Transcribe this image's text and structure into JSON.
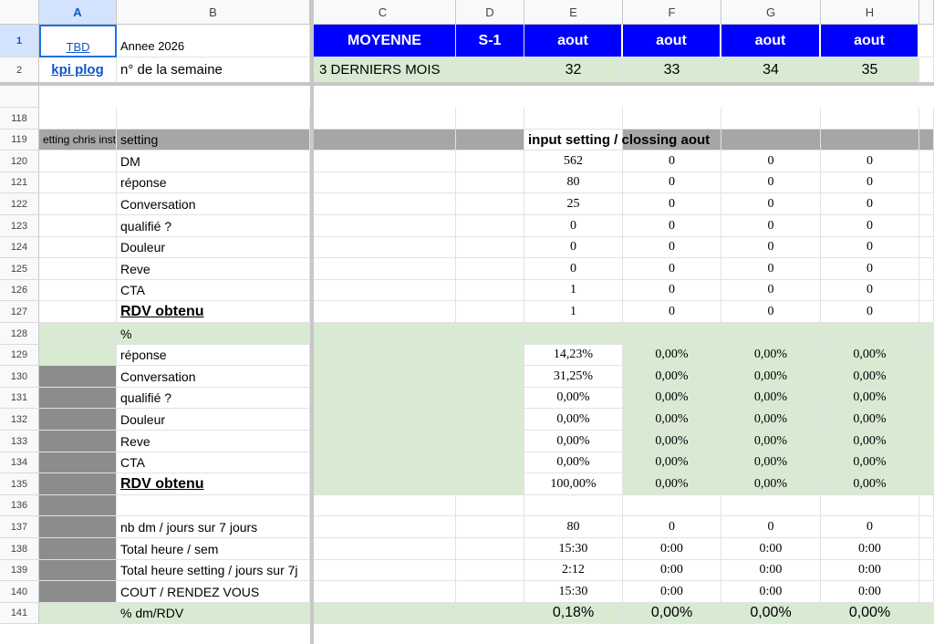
{
  "columns": [
    "A",
    "B",
    "C",
    "D",
    "E",
    "F",
    "G",
    "H"
  ],
  "header": {
    "row1_num": "1",
    "row2_num": "2",
    "a1": "TBD",
    "b1": "Annee 2026",
    "c1": "MOYENNE",
    "d1": "S-1",
    "months": [
      "aout",
      "aout",
      "aout",
      "aout"
    ],
    "a2": "kpi plog",
    "b2": "n° de la semaine",
    "c2": "3 DERNIERS MOIS",
    "weeks": [
      "32",
      "33",
      "34",
      "35"
    ]
  },
  "rows": [
    {
      "num": "118",
      "label": "",
      "vals": [
        "",
        "",
        "",
        ""
      ],
      "style": ""
    },
    {
      "num": "119",
      "label": "setting",
      "vals": [
        "",
        "",
        "",
        ""
      ],
      "style": "title"
    },
    {
      "num": "120",
      "label": "DM",
      "vals": [
        "562",
        "0",
        "0",
        "0"
      ],
      "style": ""
    },
    {
      "num": "121",
      "label": "réponse",
      "vals": [
        "80",
        "0",
        "0",
        "0"
      ],
      "style": ""
    },
    {
      "num": "122",
      "label": "Conversation",
      "vals": [
        "25",
        "0",
        "0",
        "0"
      ],
      "style": ""
    },
    {
      "num": "123",
      "label": "qualifié ?",
      "vals": [
        "0",
        "0",
        "0",
        "0"
      ],
      "style": ""
    },
    {
      "num": "124",
      "label": "Douleur",
      "vals": [
        "0",
        "0",
        "0",
        "0"
      ],
      "style": ""
    },
    {
      "num": "125",
      "label": "Reve",
      "vals": [
        "0",
        "0",
        "0",
        "0"
      ],
      "style": ""
    },
    {
      "num": "126",
      "label": "CTA",
      "vals": [
        "1",
        "0",
        "0",
        "0"
      ],
      "style": ""
    },
    {
      "num": "127",
      "label": "RDV obtenu",
      "vals": [
        "1",
        "0",
        "0",
        "0"
      ],
      "style": "bold"
    },
    {
      "num": "128",
      "label": "%",
      "vals": [
        "",
        "",
        "",
        ""
      ],
      "style": "greenrow"
    },
    {
      "num": "129",
      "label": "réponse",
      "vals": [
        "14,23%",
        "0,00%",
        "0,00%",
        "0,00%"
      ],
      "style": "pct"
    },
    {
      "num": "130",
      "label": "Conversation",
      "vals": [
        "31,25%",
        "0,00%",
        "0,00%",
        "0,00%"
      ],
      "style": "pct"
    },
    {
      "num": "131",
      "label": "qualifié ?",
      "vals": [
        "0,00%",
        "0,00%",
        "0,00%",
        "0,00%"
      ],
      "style": "pct"
    },
    {
      "num": "132",
      "label": "Douleur",
      "vals": [
        "0,00%",
        "0,00%",
        "0,00%",
        "0,00%"
      ],
      "style": "pct"
    },
    {
      "num": "133",
      "label": "Reve",
      "vals": [
        "0,00%",
        "0,00%",
        "0,00%",
        "0,00%"
      ],
      "style": "pct"
    },
    {
      "num": "134",
      "label": "CTA",
      "vals": [
        "0,00%",
        "0,00%",
        "0,00%",
        "0,00%"
      ],
      "style": "pct"
    },
    {
      "num": "135",
      "label": "RDV obtenu",
      "vals": [
        "100,00%",
        "0,00%",
        "0,00%",
        "0,00%"
      ],
      "style": "pctbold"
    },
    {
      "num": "136",
      "label": "",
      "vals": [
        "",
        "",
        "",
        ""
      ],
      "style": "gray"
    },
    {
      "num": "137",
      "label": "nb dm / jours sur 7 jours",
      "vals": [
        "80",
        "0",
        "0",
        "0"
      ],
      "style": "gray"
    },
    {
      "num": "138",
      "label": "Total heure / sem",
      "vals": [
        "15:30",
        "0:00",
        "0:00",
        "0:00"
      ],
      "style": "gray"
    },
    {
      "num": "139",
      "label": "Total heure setting / jours sur 7j",
      "vals": [
        "2:12",
        "0:00",
        "0:00",
        "0:00"
      ],
      "style": "gray"
    },
    {
      "num": "140",
      "label": "COUT / RENDEZ VOUS",
      "vals": [
        "15:30",
        "0:00",
        "0:00",
        "0:00"
      ],
      "style": "gray"
    },
    {
      "num": "141",
      "label": "% dm/RDV",
      "vals": [
        "0,18%",
        "0,00%",
        "0,00%",
        "0,00%"
      ],
      "style": "final"
    }
  ],
  "row119_a": "etting chris inst",
  "row119_title": "input setting / clossing aout",
  "colors": {
    "blue": "#0000ff",
    "green": "#d9ead3",
    "gray": "#a6a6a6"
  }
}
